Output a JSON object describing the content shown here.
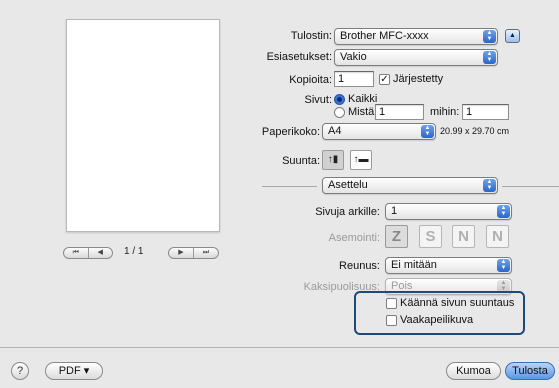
{
  "preview": {
    "page_count": "1 / 1",
    "nav_back_icons": [
      "⏮",
      "◀"
    ],
    "nav_fwd_icons": [
      "▶",
      "⏭"
    ]
  },
  "printer": {
    "label": "Tulostin:",
    "value": "Brother MFC-xxxx"
  },
  "presets": {
    "label": "Esiasetukset:",
    "value": "Vakio"
  },
  "copies": {
    "label": "Kopioita:",
    "value": "1",
    "collated_label": "Järjestetty",
    "collated_checked": "✓"
  },
  "pages": {
    "label": "Sivut:",
    "all_label": "Kaikki",
    "from_label": "Mistä:",
    "from_value": "1",
    "to_label": "mihin:",
    "to_value": "1"
  },
  "paper_size": {
    "label": "Paperikoko:",
    "value": "A4",
    "dims": "20.99 x 29.70 cm"
  },
  "orientation": {
    "label": "Suunta:",
    "portrait_glyph": "↑▮",
    "landscape_glyph": "↑▬"
  },
  "section": {
    "value": "Asettelu"
  },
  "layout": {
    "pages_per_sheet_label": "Sivuja arkille:",
    "pages_per_sheet_value": "1",
    "direction_label": "Asemointi:",
    "direction_glyphs": [
      "Z",
      "S",
      "N",
      "N"
    ],
    "border_label": "Reunus:",
    "border_value": "Ei mitään",
    "two_sided_label": "Kaksipuolisuus:",
    "two_sided_value": "Pois",
    "reverse_orientation_label": "Käännä sivun suuntaus",
    "flip_horizontal_label": "Vaakapeilikuva"
  },
  "footer": {
    "help_glyph": "?",
    "pdf_label": "PDF ▾",
    "cancel_label": "Kumoa",
    "print_label": "Tulosta"
  },
  "colors": {
    "accent": "#2a66cc",
    "group_border": "#1f4a78"
  }
}
